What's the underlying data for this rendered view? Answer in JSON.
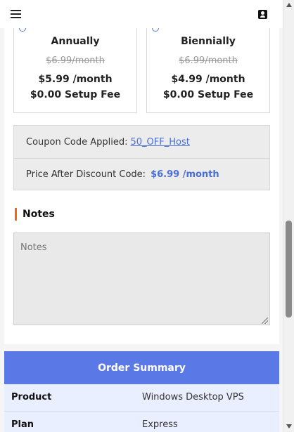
{
  "header": {
    "menu_icon": "hamburger-menu-icon",
    "account_icon": "user-account-icon"
  },
  "billing_cycles": [
    {
      "name": "Annually",
      "original_price": "$6.99/month",
      "price": "$5.99 /month",
      "setup_fee": "$0.00 Setup Fee"
    },
    {
      "name": "Biennially",
      "original_price": "$6.99/month",
      "price": "$4.99 /month",
      "setup_fee": "$0.00 Setup Fee"
    }
  ],
  "coupon": {
    "applied_label": "Coupon Code Applied:",
    "code": "50_OFF_Host",
    "discount_label": "Price After Discount Code:",
    "discount_price": "$6.99 /month"
  },
  "notes": {
    "heading": "Notes",
    "placeholder": "Notes"
  },
  "order_summary": {
    "title": "Order Summary",
    "rows": [
      {
        "key": "Product",
        "value": "Windows Desktop VPS"
      },
      {
        "key": "Plan",
        "value": "Express"
      }
    ]
  },
  "colors": {
    "accent_blue": "#5b79e6",
    "link_blue": "#4a6fd6",
    "notes_accent": "#e86a1c"
  }
}
